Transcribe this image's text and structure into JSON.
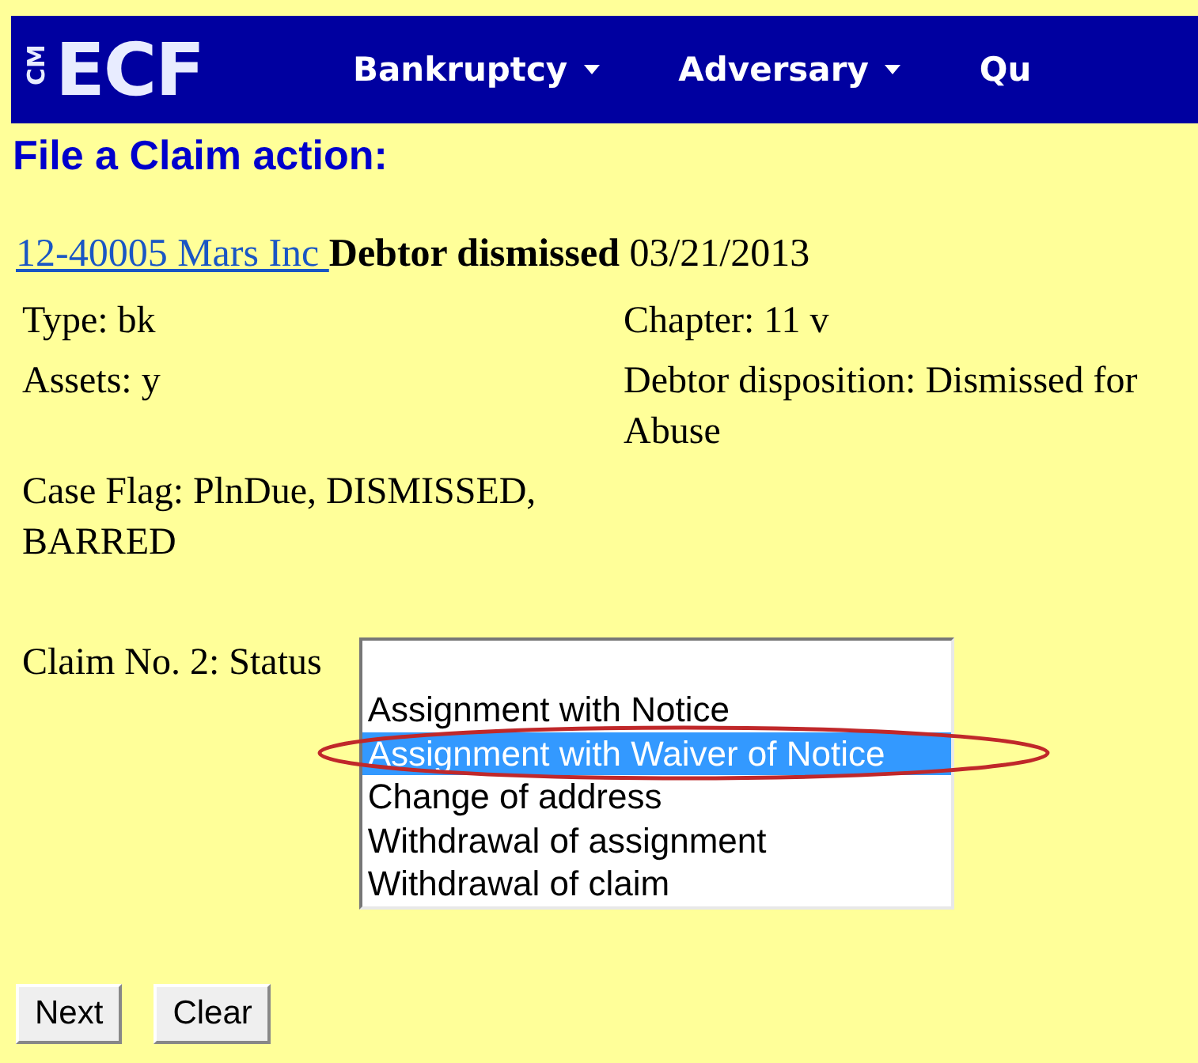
{
  "logo": {
    "small": "CM",
    "large": "ECF"
  },
  "menu": [
    {
      "label": "Bankruptcy",
      "dropdown": true
    },
    {
      "label": "Adversary",
      "dropdown": true
    },
    {
      "label": "Qu",
      "dropdown": false
    }
  ],
  "title": "File a Claim action:",
  "case": {
    "link": "12-40005 Mars Inc ",
    "status": "Debtor dismissed",
    "date": "03/21/2013"
  },
  "details": [
    {
      "left": "Type: bk",
      "right": "Chapter: 11 v"
    },
    {
      "left": "Assets: y",
      "right": "Debtor disposition: Dismissed for Abuse"
    },
    {
      "left": "Case Flag: PlnDue, DISMISSED, BARRED"
    }
  ],
  "status_field": {
    "label": "Claim No. 2: Status",
    "options": [
      {
        "label": "Assignment with Notice",
        "selected": false
      },
      {
        "label": "Assignment with Waiver of Notice",
        "selected": true
      },
      {
        "label": "Change of address",
        "selected": false
      },
      {
        "label": "Withdrawal of assignment",
        "selected": false
      },
      {
        "label": "Withdrawal of claim",
        "selected": false
      }
    ]
  },
  "buttons": [
    "Next",
    "Clear"
  ]
}
